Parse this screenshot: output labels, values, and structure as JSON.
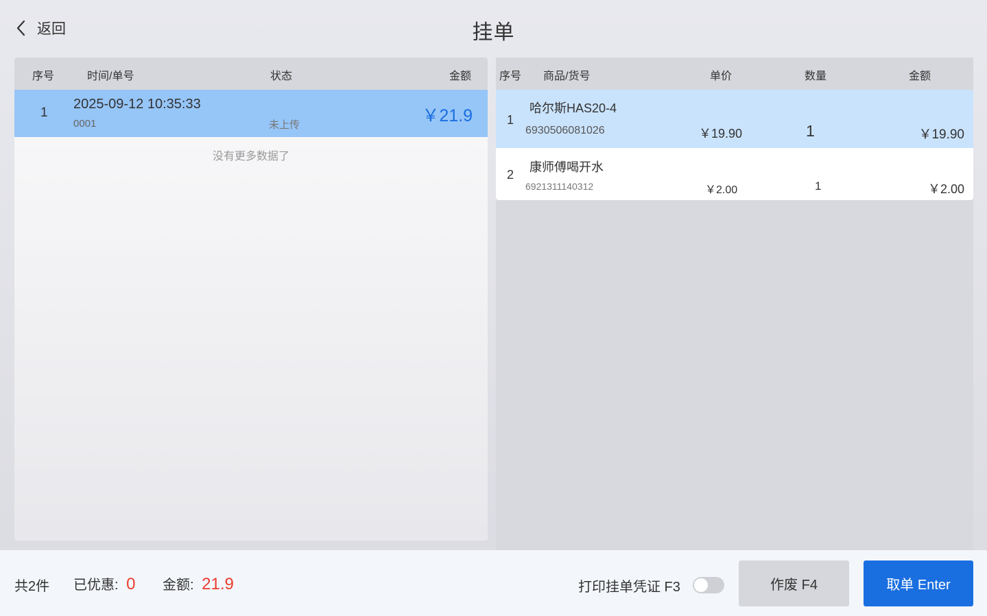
{
  "header": {
    "back_label": "返回",
    "title": "挂单"
  },
  "orders": {
    "columns": {
      "index": "序号",
      "time_no": "时间/单号",
      "status": "状态",
      "amount": "金额"
    },
    "rows": [
      {
        "index": "1",
        "time": "2025-09-12 10:35:33",
        "number": "0001",
        "status": "未上传",
        "amount": "￥21.9"
      }
    ],
    "no_more": "没有更多数据了"
  },
  "items": {
    "columns": {
      "index": "序号",
      "product": "商品/货号",
      "unit_price": "单价",
      "qty": "数量",
      "amount": "金额"
    },
    "rows": [
      {
        "index": "1",
        "name": "哈尔斯HAS20-4",
        "code": "6930506081026",
        "unit_price": "￥19.90",
        "qty": "1",
        "amount": "￥19.90"
      },
      {
        "index": "2",
        "name": "康师傅喝开水",
        "code": "6921311140312",
        "unit_price": "￥2.00",
        "qty": "1",
        "amount": "￥2.00"
      }
    ]
  },
  "footer": {
    "total_count": "共2件",
    "discount_label": "已优惠:",
    "discount_value": "0",
    "amount_label": "金额:",
    "amount_value": "21.9",
    "print_label": "打印挂单凭证 F3",
    "print_toggle_on": false,
    "void_label": "作废 F4",
    "take_label": "取单 Enter"
  },
  "colors": {
    "accent": "#1a6fe0",
    "selected_row": "#96c5f7",
    "highlight_row": "#cae3fc",
    "red": "#ea3d2f"
  },
  "icons": {
    "back": "chevron-left-icon"
  }
}
